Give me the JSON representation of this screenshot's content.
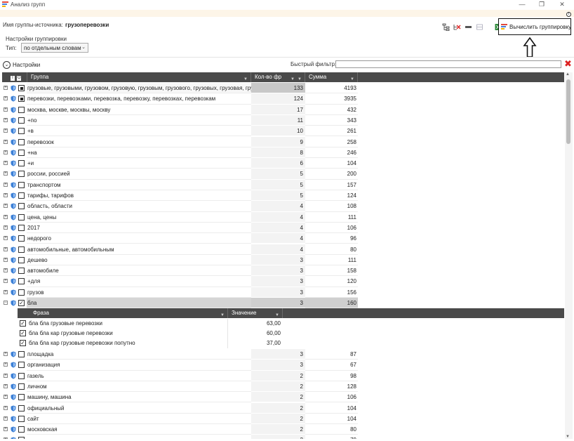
{
  "window": {
    "title": "Анализ групп",
    "minimize_glyph": "—",
    "restore_glyph": "❐",
    "close_glyph": "✕"
  },
  "source": {
    "label": "Имя группы-источника:",
    "value": "грузоперевозки"
  },
  "toolbar": {
    "compute_label": "Вычислить группировку",
    "info_glyph": "!"
  },
  "group_settings": {
    "title": "Настройки группировки",
    "type_label": "Тип:",
    "type_value": "по отдельным словам"
  },
  "settings_toggle": {
    "label": "Настройки"
  },
  "filter": {
    "label": "Быстрый фильтр:",
    "value": ""
  },
  "grid": {
    "header_icons": [
      "I",
      "O"
    ],
    "columns": {
      "group": "Группа",
      "count": "Кол-во фр",
      "sum": "Сумма"
    },
    "rows": [
      {
        "name": "грузовые, грузовыми, грузовом, грузовую, грузовым, грузового, грузовых, грузовая, груз",
        "count": "133",
        "sum": "4193",
        "state": "filled",
        "expand": "+"
      },
      {
        "name": "перевозки, перевозками, перевозка, перевозку, перевозках, перевозкам",
        "count": "124",
        "sum": "3935",
        "state": "filled",
        "expand": "+"
      },
      {
        "name": "москва, москве, москвы, москву",
        "count": "17",
        "sum": "432",
        "state": "empty",
        "expand": "+"
      },
      {
        "name": "+по",
        "count": "11",
        "sum": "343",
        "state": "empty",
        "expand": "+"
      },
      {
        "name": "+в",
        "count": "10",
        "sum": "261",
        "state": "empty",
        "expand": "+"
      },
      {
        "name": "перевозок",
        "count": "9",
        "sum": "258",
        "state": "empty",
        "expand": "+"
      },
      {
        "name": "+на",
        "count": "8",
        "sum": "246",
        "state": "empty",
        "expand": "+"
      },
      {
        "name": "+и",
        "count": "6",
        "sum": "104",
        "state": "empty",
        "expand": "+"
      },
      {
        "name": "россии, россией",
        "count": "5",
        "sum": "200",
        "state": "empty",
        "expand": "+"
      },
      {
        "name": "транспортом",
        "count": "5",
        "sum": "157",
        "state": "empty",
        "expand": "+"
      },
      {
        "name": "тарифы, тарифов",
        "count": "5",
        "sum": "124",
        "state": "empty",
        "expand": "+"
      },
      {
        "name": "область, области",
        "count": "4",
        "sum": "108",
        "state": "empty",
        "expand": "+"
      },
      {
        "name": "цена, цены",
        "count": "4",
        "sum": "111",
        "state": "empty",
        "expand": "+"
      },
      {
        "name": "2017",
        "count": "4",
        "sum": "106",
        "state": "empty",
        "expand": "+"
      },
      {
        "name": "недорого",
        "count": "4",
        "sum": "96",
        "state": "empty",
        "expand": "+"
      },
      {
        "name": "автомобильные, автомобильным",
        "count": "4",
        "sum": "80",
        "state": "empty",
        "expand": "+"
      },
      {
        "name": "дешево",
        "count": "3",
        "sum": "111",
        "state": "empty",
        "expand": "+"
      },
      {
        "name": "автомобиле",
        "count": "3",
        "sum": "158",
        "state": "empty",
        "expand": "+"
      },
      {
        "name": "+для",
        "count": "3",
        "sum": "120",
        "state": "empty",
        "expand": "+"
      },
      {
        "name": "грузов",
        "count": "3",
        "sum": "156",
        "state": "empty",
        "expand": "+"
      },
      {
        "name": "бла",
        "count": "3",
        "sum": "160",
        "state": "checked",
        "expand": "−"
      }
    ],
    "rows_after": [
      {
        "name": "площадка",
        "count": "3",
        "sum": "87",
        "state": "empty",
        "expand": "+"
      },
      {
        "name": "организация",
        "count": "3",
        "sum": "67",
        "state": "empty",
        "expand": "+"
      },
      {
        "name": "газель",
        "count": "2",
        "sum": "98",
        "state": "empty",
        "expand": "+"
      },
      {
        "name": "личном",
        "count": "2",
        "sum": "128",
        "state": "empty",
        "expand": "+"
      },
      {
        "name": "машину, машина",
        "count": "2",
        "sum": "106",
        "state": "empty",
        "expand": "+"
      },
      {
        "name": "официальный",
        "count": "2",
        "sum": "104",
        "state": "empty",
        "expand": "+"
      },
      {
        "name": "сайт",
        "count": "2",
        "sum": "104",
        "state": "empty",
        "expand": "+"
      },
      {
        "name": "московская",
        "count": "2",
        "sum": "80",
        "state": "empty",
        "expand": "+"
      },
      {
        "name": "",
        "count": "2",
        "sum": "79",
        "state": "empty",
        "expand": "+"
      }
    ]
  },
  "subgrid": {
    "columns": {
      "phrase": "Фраза",
      "value": "Значение"
    },
    "rows": [
      {
        "phrase": "бла бла грузовые перевозки",
        "value": "63,00"
      },
      {
        "phrase": "бла бла кар грузовые перевозки",
        "value": "60,00"
      },
      {
        "phrase": "бла бла кар грузовые перевозки попутно",
        "value": "37,00"
      }
    ]
  },
  "colors": {
    "header_bg": "#4a4a4a",
    "source_bar_bg": "#fdf5e8",
    "shield_blue": "#3b7fd6",
    "clear_red": "#dd2222"
  }
}
